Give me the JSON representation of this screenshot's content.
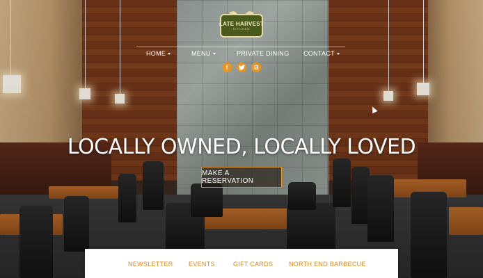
{
  "logo": {
    "title": "LATE HARVEST",
    "subtitle": "KITCHEN"
  },
  "nav": {
    "items": [
      {
        "label": "HOME",
        "has_dropdown": true
      },
      {
        "label": "MENU",
        "has_dropdown": true
      },
      {
        "label": "PRIVATE DINING",
        "has_dropdown": false
      },
      {
        "label": "CONTACT",
        "has_dropdown": true
      }
    ]
  },
  "social": {
    "facebook_glyph": "f",
    "icons": [
      "facebook-icon",
      "twitter-icon",
      "instagram-icon"
    ],
    "color": "#e89521"
  },
  "hero": {
    "headline": "LOCALLY OWNED, LOCALLY LOVED",
    "cta_label": "MAKE A RESERVATION",
    "accent_color": "#e89521"
  },
  "tabs": {
    "items": [
      {
        "label": "NEWSLETTER"
      },
      {
        "label": "EVENTS"
      },
      {
        "label": "GIFT CARDS"
      },
      {
        "label": "NORTH END BARBECUE"
      }
    ],
    "color": "#d98a1c"
  }
}
